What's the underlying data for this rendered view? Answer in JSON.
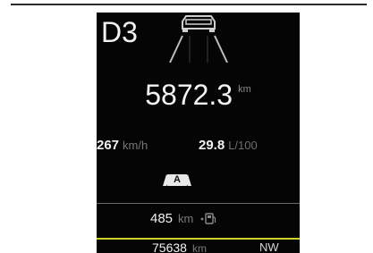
{
  "cluster": {
    "gear": "D3",
    "odometer": {
      "value": "5872.3",
      "unit": "km"
    },
    "speed": {
      "value": "267",
      "unit": "km/h"
    },
    "consumption": {
      "value": "29.8",
      "unit": "L/100"
    },
    "auto_badge": "A",
    "range": {
      "value": "485",
      "unit": "km"
    },
    "trip": {
      "value": "75638",
      "unit": "km"
    },
    "heading": "NW",
    "icons": {
      "car": "car-lane-assist-icon",
      "fuel": "fuel-pump-icon"
    },
    "colors": {
      "background": "#050505",
      "text": "#f2f2f2",
      "unit_text": "#7a7a7a",
      "accent_line": "#c9d22a"
    }
  }
}
